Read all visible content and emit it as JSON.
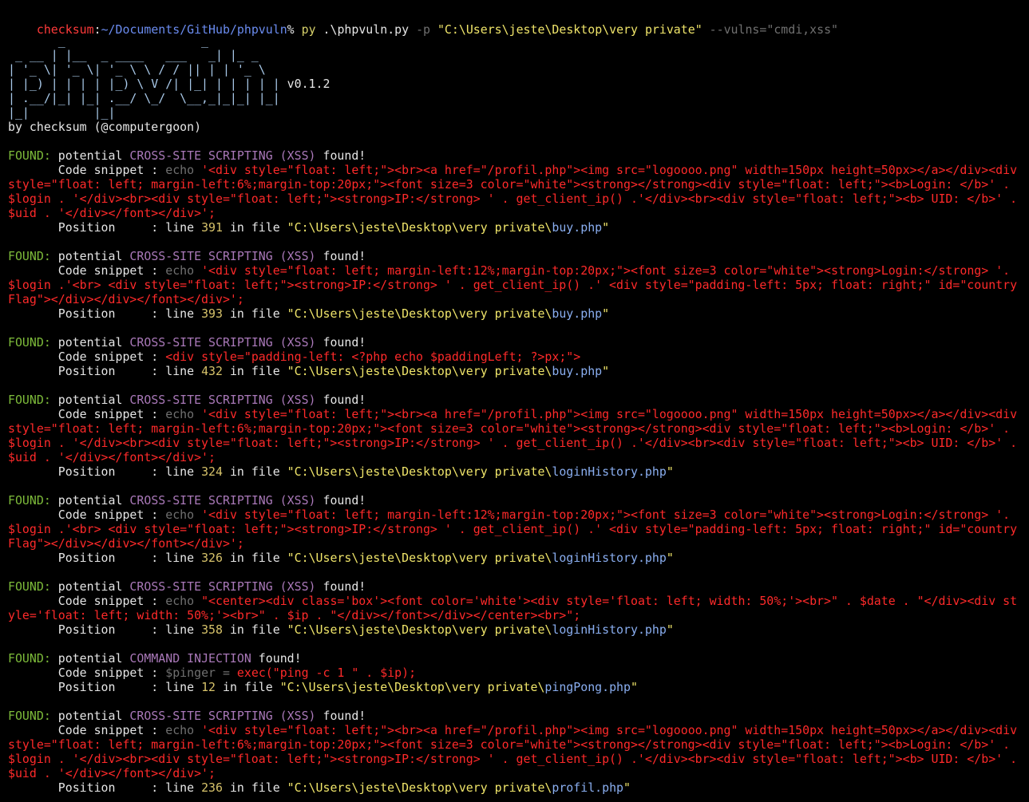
{
  "prompt": {
    "user": "checksum",
    "sep": ":",
    "path": "~/Documents/GitHub/phpvuln",
    "symbol": "% ",
    "cmd_py": "py",
    "cmd_script": " .\\phpvuln.py ",
    "cmd_flag_p": "-p",
    "cmd_path_arg": " \"C:\\Users\\jeste\\Desktop\\very private\" ",
    "cmd_vulns_flag": "--vulns=\"cmdi,xss\""
  },
  "banner": {
    "art": [
      "       _                   _",
      " _ __ | |__  _ ____   ___   _| |_ _",
      "| '_ \\| '_ \\| '_ \\ \\ / / || | | '_ \\",
      "| |_) | | | | |_) \\ V /| |_| | | | | |",
      "| .__/|_| |_| .__/ \\_/  \\__,_|_|_| |_|",
      "|_|         |_|"
    ],
    "version": "v0.1.2",
    "author": "by checksum (@computergoon)"
  },
  "labels": {
    "found": "FOUND:",
    "potential": " potential ",
    "found_suffix": " found!",
    "code_snippet": "Code snippet : ",
    "position": "Position     : ",
    "line_word": "line ",
    "in_file": " in file ",
    "echo": "echo "
  },
  "findings": [
    {
      "vuln": "CROSS-SITE SCRIPTING (XSS)",
      "echo": true,
      "snippet": "'<div style=\"float: left;\"><br><a href=\"/profil.php\"><img src=\"logoooo.png\" width=150px height=50px></a></div><div style=\"float: left; margin-left:6%;margin-top:20px;\"><font size=3 color=\"white\"><strong></strong><div style=\"float: left;\"><b>Login: </b>' . $login . '</div><br><div style=\"float: left;\"><strong>IP:</strong> ' . get_client_ip() .'</div><br><div style=\"float: left;\"><b> UID: </b>' . $uid . '</div></font></div>';",
      "line": "391",
      "file_dir": "\"C:\\Users\\jeste\\Desktop\\very private\\",
      "file_name": "buy.php",
      "file_end": "\""
    },
    {
      "vuln": "CROSS-SITE SCRIPTING (XSS)",
      "echo": true,
      "snippet": "'<div style=\"float: left; margin-left:12%;margin-top:20px;\"><font size=3 color=\"white\"><strong>Login:</strong> '. $login .'<br> <div style=\"float: left;\"><strong>IP:</strong> ' . get_client_ip() .' <div style=\"padding-left: 5px; float: right;\" id=\"countryFlag\"></div></div></font></div>';",
      "line": "393",
      "file_dir": "\"C:\\Users\\jeste\\Desktop\\very private\\",
      "file_name": "buy.php",
      "file_end": "\""
    },
    {
      "vuln": "CROSS-SITE SCRIPTING (XSS)",
      "echo": false,
      "snippet": "<div style=\"padding-left: <?php echo $paddingLeft; ?>px;\">",
      "line": "432",
      "file_dir": "\"C:\\Users\\jeste\\Desktop\\very private\\",
      "file_name": "buy.php",
      "file_end": "\""
    },
    {
      "vuln": "CROSS-SITE SCRIPTING (XSS)",
      "echo": true,
      "snippet": "'<div style=\"float: left;\"><br><a href=\"/profil.php\"><img src=\"logoooo.png\" width=150px height=50px></a></div><div style=\"float: left; margin-left:6%;margin-top:20px;\"><font size=3 color=\"white\"><strong></strong><div style=\"float: left;\"><b>Login: </b>' . $login . '</div><br><div style=\"float: left;\"><strong>IP:</strong> ' . get_client_ip() .'</div><br><div style=\"float: left;\"><b> UID: </b>' . $uid . '</div></font></div>';",
      "line": "324",
      "file_dir": "\"C:\\Users\\jeste\\Desktop\\very private\\",
      "file_name": "loginHistory.php",
      "file_end": "\""
    },
    {
      "vuln": "CROSS-SITE SCRIPTING (XSS)",
      "echo": true,
      "snippet": "'<div style=\"float: left; margin-left:12%;margin-top:20px;\"><font size=3 color=\"white\"><strong>Login:</strong> '. $login .'<br> <div style=\"float: left;\"><strong>IP:</strong> ' . get_client_ip() .' <div style=\"padding-left: 5px; float: right;\" id=\"countryFlag\"></div></div></font></div>';",
      "line": "326",
      "file_dir": "\"C:\\Users\\jeste\\Desktop\\very private\\",
      "file_name": "loginHistory.php",
      "file_end": "\""
    },
    {
      "vuln": "CROSS-SITE SCRIPTING (XSS)",
      "echo": true,
      "snippet": "\"<center><div class='box'><font color='white'><div style='float: left; width: 50%;'><br>\" . $date . \"</div><div style='float: left; width: 50%;'><br>\" . $ip . \"</div></font></div></center><br>\";",
      "line": "358",
      "file_dir": "\"C:\\Users\\jeste\\Desktop\\very private\\",
      "file_name": "loginHistory.php",
      "file_end": "\""
    },
    {
      "vuln": "COMMAND INJECTION",
      "echo": false,
      "cmdi": true,
      "snippet_var": "$pinger",
      "snippet_eq": " = ",
      "snippet_rest": "exec(\"ping -c 1 \" . $ip);",
      "line": "12",
      "file_dir": "\"C:\\Users\\jeste\\Desktop\\very private\\",
      "file_name": "pingPong.php",
      "file_end": "\""
    },
    {
      "vuln": "CROSS-SITE SCRIPTING (XSS)",
      "echo": true,
      "snippet": "'<div style=\"float: left;\"><br><a href=\"/profil.php\"><img src=\"logoooo.png\" width=150px height=50px></a></div><div style=\"float: left; margin-left:6%;margin-top:20px;\"><font size=3 color=\"white\"><strong></strong><div style=\"float: left;\"><b>Login: </b>' . $login . '</div><br><div style=\"float: left;\"><strong>IP:</strong> ' . get_client_ip() .'</div><br><div style=\"float: left;\"><b> UID: </b>' . $uid . '</div></font></div>';",
      "line": "236",
      "file_dir": "\"C:\\Users\\jeste\\Desktop\\very private\\",
      "file_name": "profil.php",
      "file_end": "\""
    }
  ]
}
